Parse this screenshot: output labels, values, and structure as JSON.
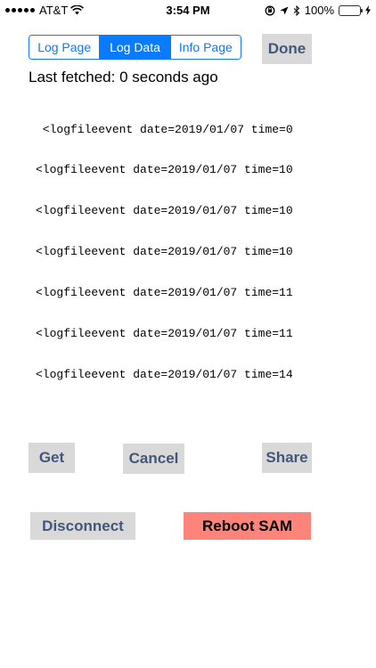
{
  "status_bar": {
    "carrier": "AT&T",
    "time": "3:54 PM",
    "battery": "100%"
  },
  "tabs": [
    {
      "label": "Log Page",
      "active": false
    },
    {
      "label": "Log Data",
      "active": true
    },
    {
      "label": "Info Page",
      "active": false
    }
  ],
  "done_label": "Done",
  "last_fetched": "Last fetched: 0 seconds ago",
  "log_lines": [
    " <logfileevent date=2019/01/07 time=0",
    "<logfileevent date=2019/01/07 time=10",
    "<logfileevent date=2019/01/07 time=10",
    "<logfileevent date=2019/01/07 time=10",
    "<logfileevent date=2019/01/07 time=11",
    "<logfileevent date=2019/01/07 time=11",
    "<logfileevent date=2019/01/07 time=14"
  ],
  "buttons": {
    "get": "Get",
    "cancel": "Cancel",
    "share": "Share",
    "disconnect": "Disconnect",
    "reboot": "Reboot SAM"
  },
  "colors": {
    "accent": "#0a7aff",
    "button_bg": "#d9d9d9",
    "button_text": "#43577b",
    "reboot_bg": "#fc847b",
    "battery": "#4cd964"
  }
}
